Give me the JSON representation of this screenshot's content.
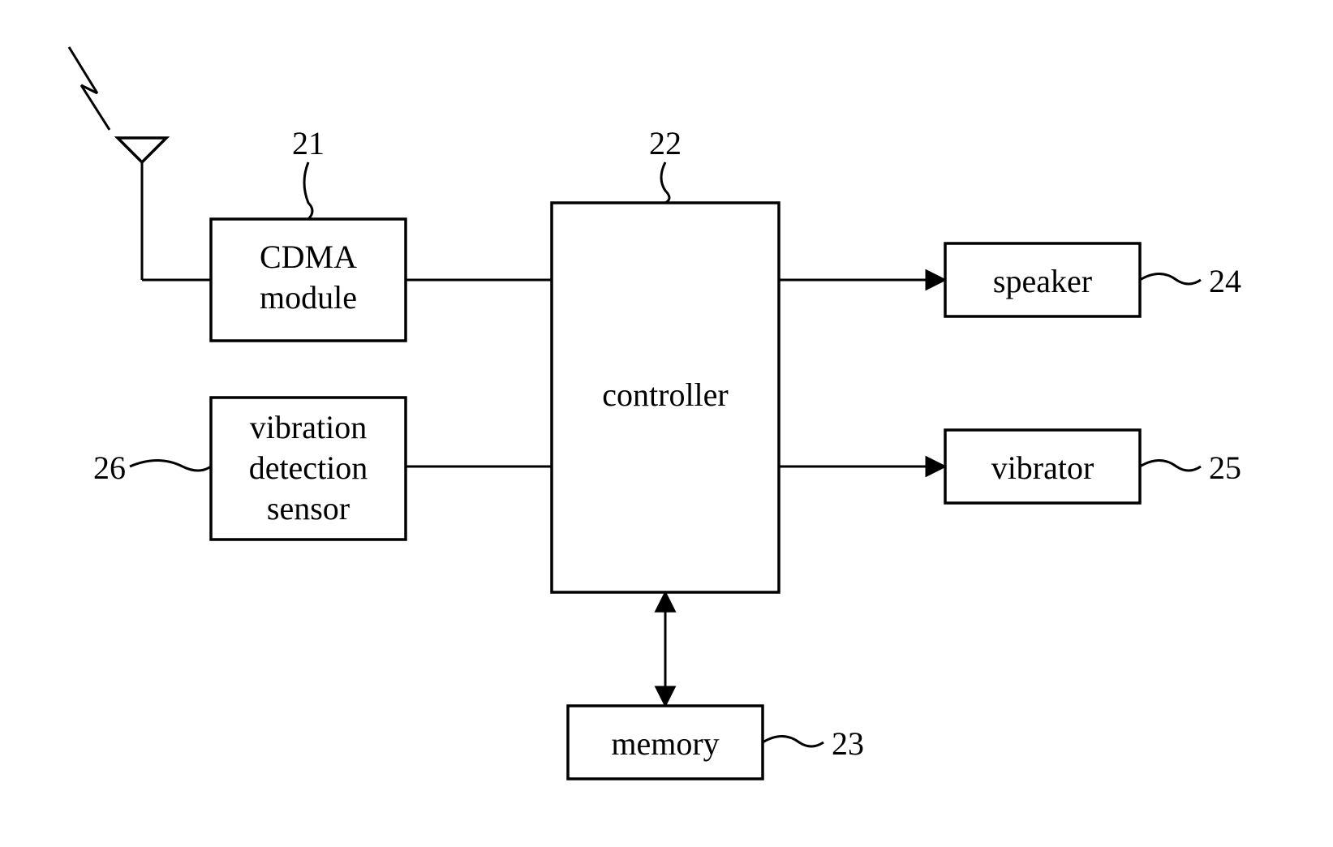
{
  "blocks": {
    "cdma": {
      "label_line1": "CDMA",
      "label_line2": "module",
      "ref": "21"
    },
    "controller": {
      "label": "controller",
      "ref": "22"
    },
    "memory": {
      "label": "memory",
      "ref": "23"
    },
    "speaker": {
      "label": "speaker",
      "ref": "24"
    },
    "vibrator": {
      "label": "vibrator",
      "ref": "25"
    },
    "vibsensor": {
      "label_line1": "vibration",
      "label_line2": "detection",
      "label_line3": "sensor",
      "ref": "26"
    }
  }
}
